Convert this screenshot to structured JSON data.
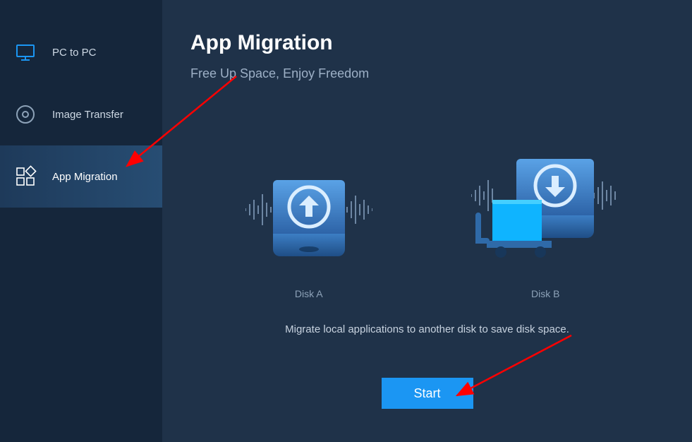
{
  "sidebar": {
    "items": [
      {
        "label": "PC to PC"
      },
      {
        "label": "Image Transfer"
      },
      {
        "label": "App Migration"
      }
    ]
  },
  "main": {
    "title": "App Migration",
    "subtitle": "Free Up Space, Enjoy Freedom",
    "disk_a_label": "Disk A",
    "disk_b_label": "Disk B",
    "description": "Migrate local applications to another disk to save disk space.",
    "start_label": "Start"
  }
}
